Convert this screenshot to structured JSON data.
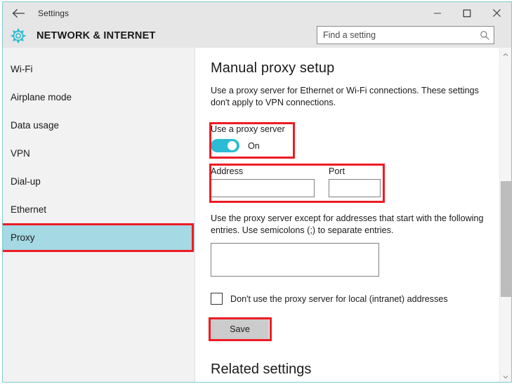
{
  "window": {
    "titlebar": {
      "back_icon": "back-arrow-icon",
      "title": "Settings",
      "minimize_label": "Minimize",
      "maximize_label": "Maximize",
      "close_label": "Close"
    },
    "header": {
      "gear_icon": "gear-icon",
      "title": "NETWORK & INTERNET",
      "accent_color": "#2BBBD4"
    },
    "search": {
      "placeholder": "Find a setting",
      "value": "",
      "icon": "search-icon"
    }
  },
  "sidebar": {
    "items": [
      {
        "label": "Wi-Fi",
        "selected": false
      },
      {
        "label": "Airplane mode",
        "selected": false
      },
      {
        "label": "Data usage",
        "selected": false
      },
      {
        "label": "VPN",
        "selected": false
      },
      {
        "label": "Dial-up",
        "selected": false
      },
      {
        "label": "Ethernet",
        "selected": false
      },
      {
        "label": "Proxy",
        "selected": true
      }
    ],
    "selected_bg": "#A5D9E3"
  },
  "main": {
    "heading": "Manual proxy setup",
    "description": "Use a proxy server for Ethernet or Wi-Fi connections. These settings don't apply to VPN connections.",
    "proxy_toggle": {
      "label": "Use a proxy server",
      "state": "On",
      "on_color": "#2BBBD4"
    },
    "address": {
      "label": "Address",
      "value": "",
      "placeholder": ""
    },
    "port": {
      "label": "Port",
      "value": "",
      "placeholder": ""
    },
    "exceptions": {
      "description": "Use the proxy server except for addresses that start with the following entries. Use semicolons (;) to separate entries.",
      "value": "",
      "placeholder": ""
    },
    "local_checkbox": {
      "label": "Don't use the proxy server for local (intranet) addresses",
      "checked": false
    },
    "save_button": "Save",
    "related_heading": "Related settings"
  },
  "annotations": {
    "color": "#ED1C24",
    "boxes": [
      {
        "name": "proxy-nav-highlight"
      },
      {
        "name": "proxy-toggle-highlight"
      },
      {
        "name": "address-port-highlight"
      },
      {
        "name": "save-button-highlight"
      }
    ]
  },
  "scrollbar": {
    "up_icon": "chevron-up-icon",
    "down_icon": "chevron-down-icon",
    "thumb_color": "#BDBDBD"
  }
}
